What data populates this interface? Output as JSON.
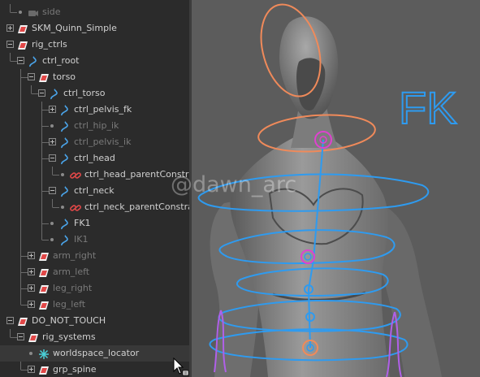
{
  "outliner": {
    "rows": [
      {
        "label": "side",
        "depth": 1,
        "expander": "none",
        "icon": "camera-icon",
        "dim": true
      },
      {
        "label": "SKM_Quinn_Simple",
        "depth": 0,
        "expander": "plus",
        "icon": "transform-group-icon",
        "dim": false
      },
      {
        "label": "rig_ctrls",
        "depth": 0,
        "expander": "minus",
        "icon": "transform-group-icon",
        "dim": false
      },
      {
        "label": "ctrl_root",
        "depth": 1,
        "expander": "minus",
        "icon": "nurbs-curve-icon",
        "dim": false
      },
      {
        "label": "torso",
        "depth": 2,
        "expander": "minus",
        "icon": "transform-group-icon",
        "dim": false
      },
      {
        "label": "ctrl_torso",
        "depth": 3,
        "expander": "minus",
        "icon": "nurbs-curve-icon",
        "dim": false
      },
      {
        "label": "ctrl_pelvis_fk",
        "depth": 4,
        "expander": "plus",
        "icon": "nurbs-curve-icon",
        "dim": false
      },
      {
        "label": "ctrl_hip_ik",
        "depth": 4,
        "expander": "none",
        "icon": "nurbs-curve-icon",
        "dim": true
      },
      {
        "label": "ctrl_pelvis_ik",
        "depth": 4,
        "expander": "plus",
        "icon": "nurbs-curve-icon",
        "dim": true
      },
      {
        "label": "ctrl_head",
        "depth": 4,
        "expander": "minus",
        "icon": "nurbs-curve-icon",
        "dim": false
      },
      {
        "label": "ctrl_head_parentConstrai",
        "depth": 5,
        "expander": "none",
        "icon": "parent-constraint-icon",
        "dim": false
      },
      {
        "label": "ctrl_neck",
        "depth": 4,
        "expander": "minus",
        "icon": "nurbs-curve-icon",
        "dim": false
      },
      {
        "label": "ctrl_neck_parentConstrain",
        "depth": 5,
        "expander": "none",
        "icon": "parent-constraint-icon",
        "dim": false
      },
      {
        "label": "FK1",
        "depth": 4,
        "expander": "none",
        "icon": "nurbs-curve-icon",
        "dim": false
      },
      {
        "label": "IK1",
        "depth": 4,
        "expander": "none",
        "icon": "nurbs-curve-icon",
        "dim": true
      },
      {
        "label": "arm_right",
        "depth": 2,
        "expander": "plus",
        "icon": "transform-group-icon",
        "dim": true
      },
      {
        "label": "arm_left",
        "depth": 2,
        "expander": "plus",
        "icon": "transform-group-icon",
        "dim": true
      },
      {
        "label": "leg_right",
        "depth": 2,
        "expander": "plus",
        "icon": "transform-group-icon",
        "dim": true
      },
      {
        "label": "leg_left",
        "depth": 2,
        "expander": "plus",
        "icon": "transform-group-icon",
        "dim": true
      },
      {
        "label": "DO_NOT_TOUCH",
        "depth": 0,
        "expander": "minus",
        "icon": "transform-group-icon",
        "dim": false
      },
      {
        "label": "rig_systems",
        "depth": 1,
        "expander": "minus",
        "icon": "transform-group-icon",
        "dim": false
      },
      {
        "label": "worldspace_locator",
        "depth": 2,
        "expander": "none",
        "icon": "locator-icon",
        "dim": false,
        "selected": true
      },
      {
        "label": "grp_spine",
        "depth": 2,
        "expander": "plus",
        "icon": "transform-group-icon",
        "dim": false
      }
    ]
  },
  "viewport": {
    "mode_label": "FK",
    "watermark": "@dawn_arc"
  },
  "colors": {
    "label": "#d0d0d0",
    "label_dim": "#7a7a7a",
    "curve_icon": "#4aa3e8",
    "group_icon": "#e24848",
    "locator_icon": "#4ad0d8",
    "ctrl_blue": "#2e9bf0",
    "ctrl_orange": "#f08a5a",
    "ctrl_magenta": "#e040d0",
    "ctrl_purple": "#b060e8"
  }
}
